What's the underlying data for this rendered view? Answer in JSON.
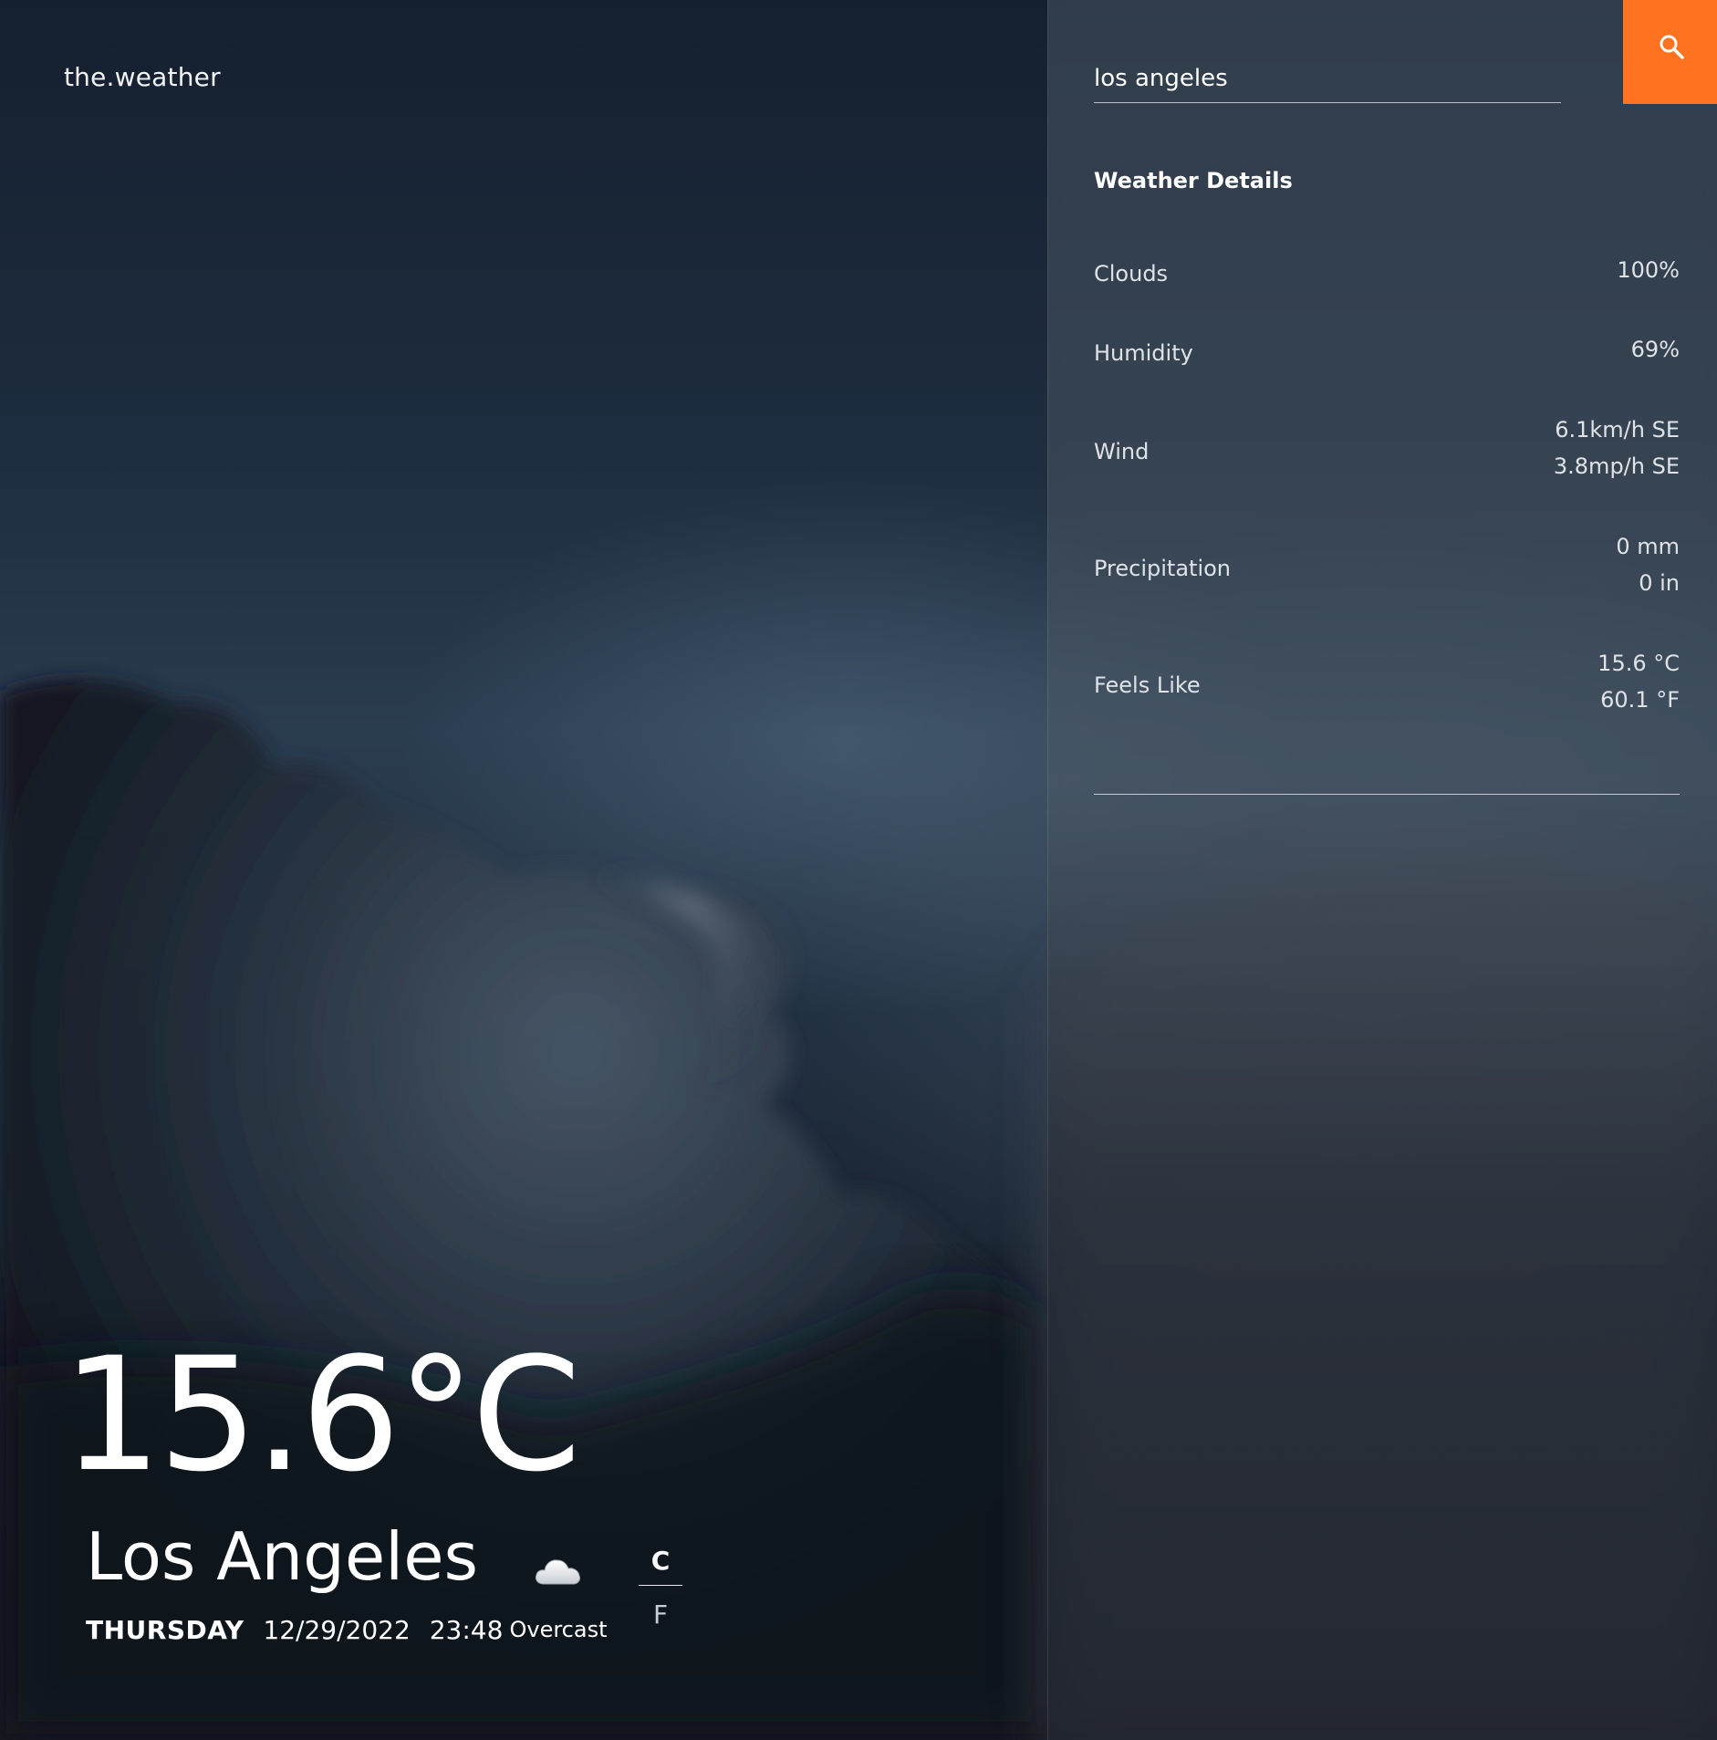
{
  "brand": "the.weather",
  "search": {
    "value": "los angeles"
  },
  "current": {
    "temperature": "15.6°C",
    "city": "Los Angeles",
    "day": "THURSDAY",
    "date": "12/29/2022",
    "time": "23:48",
    "condition": "Overcast",
    "condition_icon": "cloud-icon"
  },
  "units": {
    "celsius": "C",
    "fahrenheit": "F",
    "selected": "C"
  },
  "details": {
    "title": "Weather Details",
    "rows": [
      {
        "label": "Clouds",
        "values": [
          "100%"
        ]
      },
      {
        "label": "Humidity",
        "values": [
          "69%"
        ]
      },
      {
        "label": "Wind",
        "values": [
          "6.1km/h SE",
          "3.8mp/h SE"
        ]
      },
      {
        "label": "Precipitation",
        "values": [
          "0 mm",
          "0 in"
        ]
      },
      {
        "label": "Feels Like",
        "values": [
          "15.6 °C",
          "60.1 °F"
        ]
      }
    ]
  },
  "colors": {
    "accent": "#ff7220"
  }
}
